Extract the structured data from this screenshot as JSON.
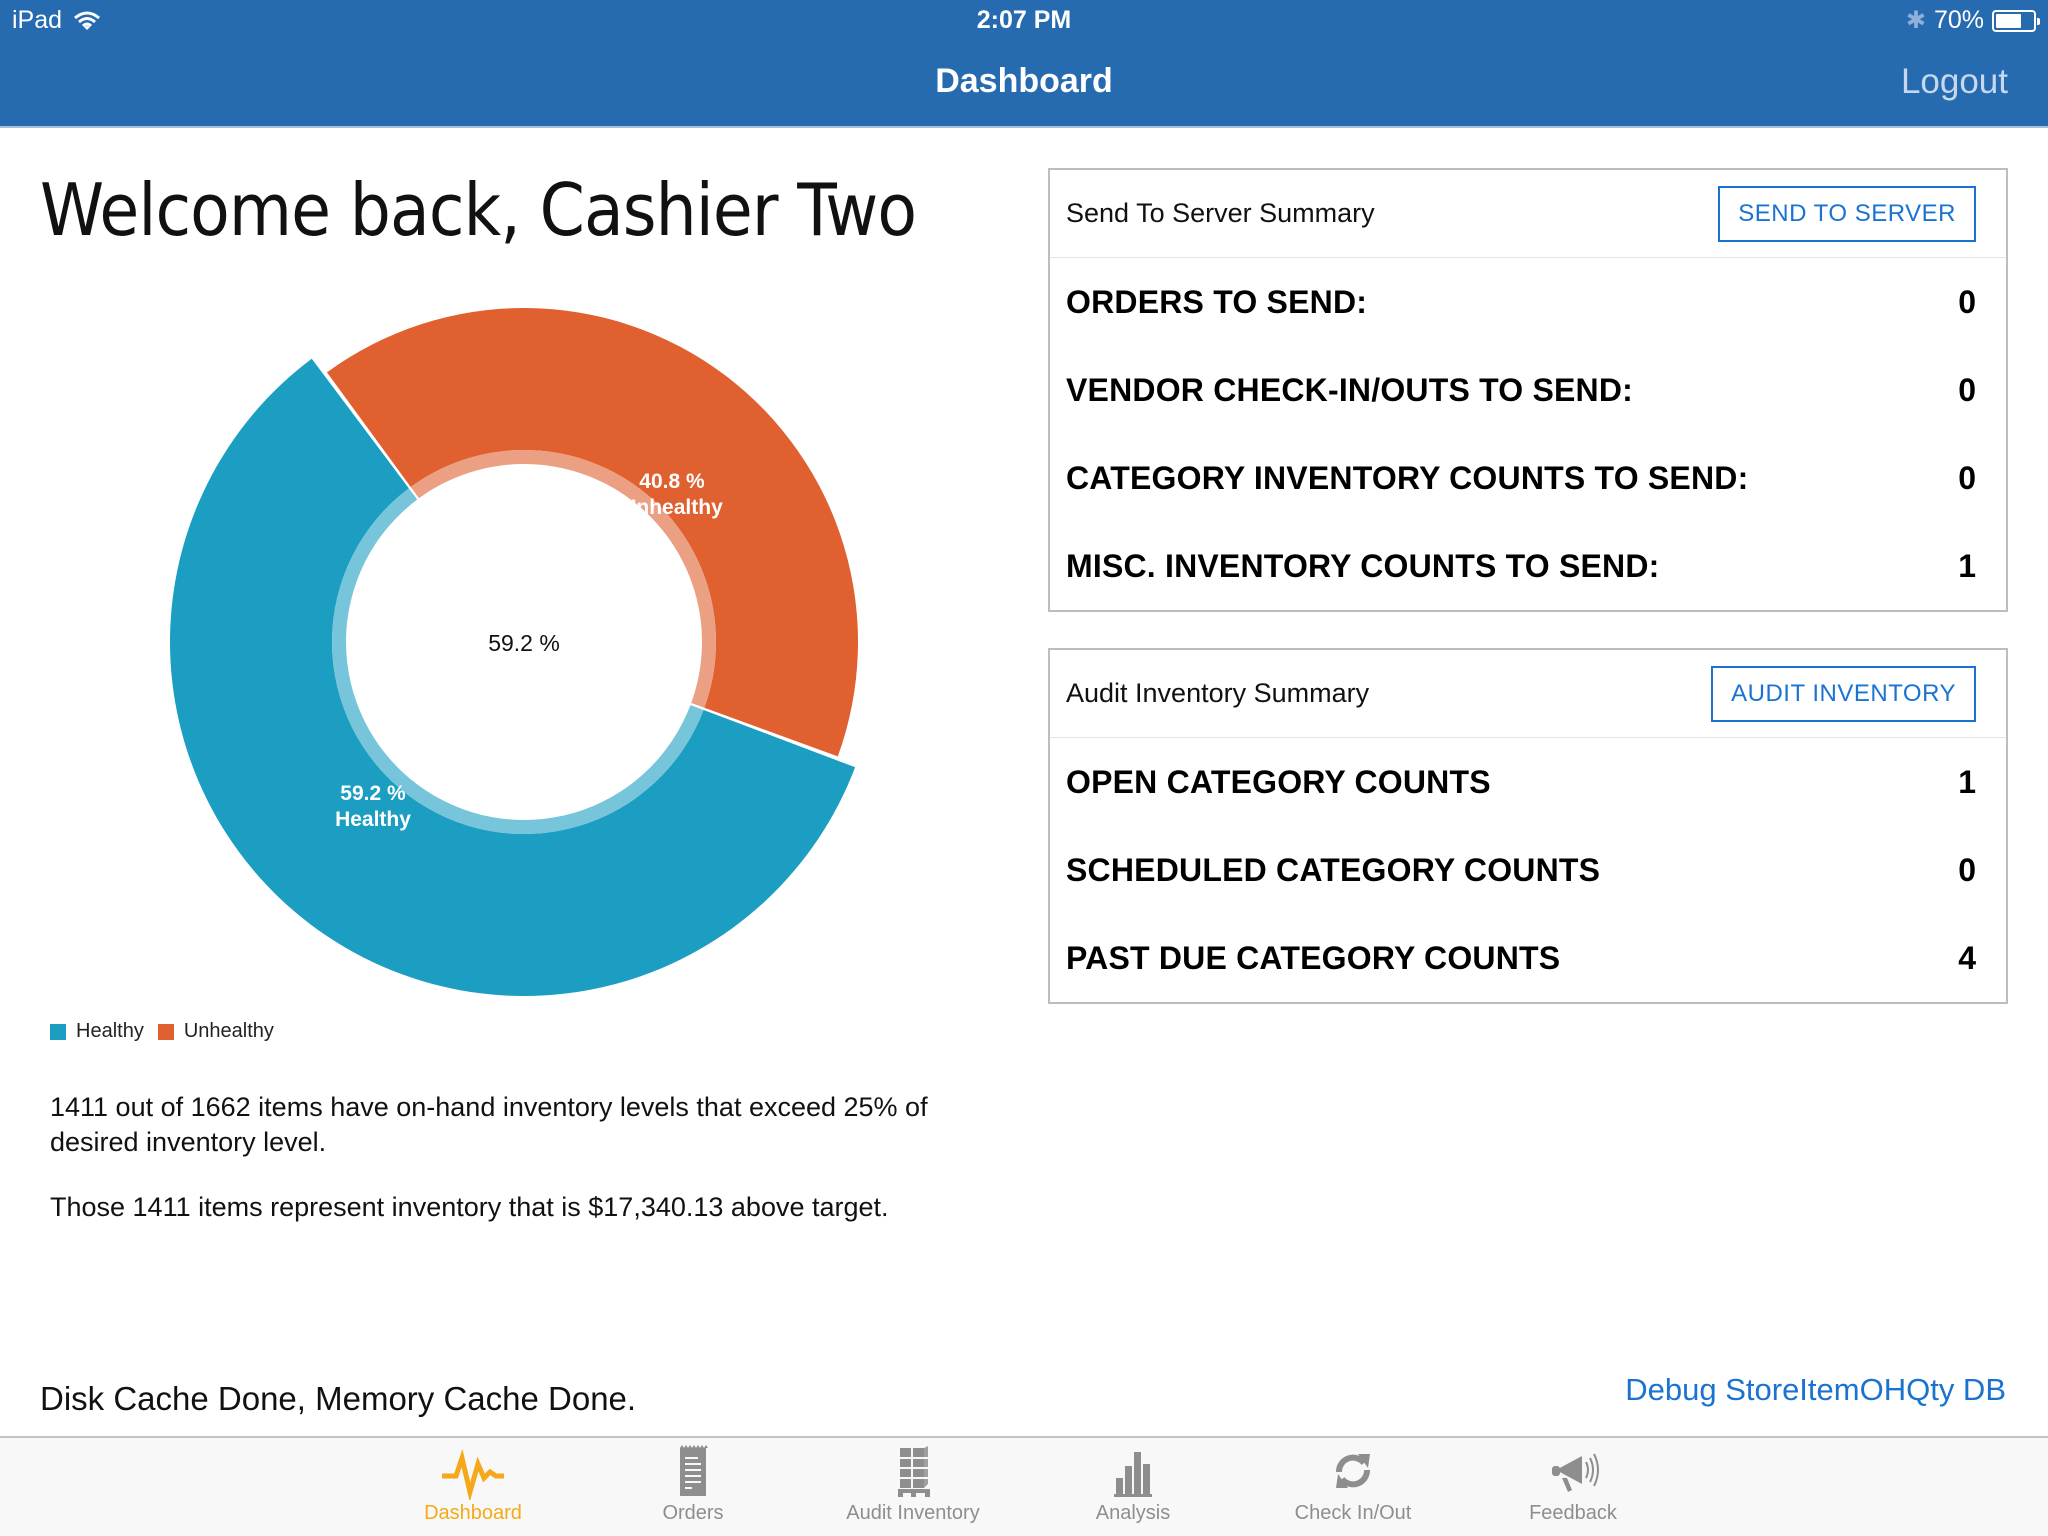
{
  "status_bar": {
    "device": "iPad",
    "time": "2:07 PM",
    "battery_percent_label": "70%",
    "battery_level": 0.7
  },
  "nav": {
    "title": "Dashboard",
    "logout_label": "Logout"
  },
  "welcome": "Welcome back, Cashier Two",
  "chart_data": {
    "type": "pie",
    "variant": "donut",
    "center_label": "59.2 %",
    "series": [
      {
        "name": "Healthy",
        "value": 59.2,
        "label_line1": "59.2 %",
        "label_line2": "Healthy",
        "color": "#1b9ec2",
        "selected": true
      },
      {
        "name": "Unhealthy",
        "value": 40.8,
        "label_line1": "40.8 %",
        "label_line2": "Unhealthy",
        "color": "#e06030",
        "selected": false
      }
    ],
    "legend": [
      "Healthy",
      "Unhealthy"
    ],
    "legend_position": "bottom-left"
  },
  "summary": {
    "line1": "1411 out of 1662 items have on-hand inventory levels that exceed 25% of desired inventory level.",
    "line2": "Those 1411 items represent inventory that is $17,340.13 above target."
  },
  "send_panel": {
    "title": "Send To Server Summary",
    "button_label": "SEND TO SERVER",
    "rows": [
      {
        "label": "ORDERS TO SEND:",
        "value": "0"
      },
      {
        "label": "VENDOR CHECK-IN/OUTS TO SEND:",
        "value": "0"
      },
      {
        "label": "CATEGORY INVENTORY COUNTS TO SEND:",
        "value": "0"
      },
      {
        "label": "MISC. INVENTORY COUNTS TO SEND:",
        "value": "1"
      }
    ]
  },
  "audit_panel": {
    "title": "Audit Inventory Summary",
    "button_label": "AUDIT INVENTORY",
    "rows": [
      {
        "label": "OPEN CATEGORY COUNTS",
        "value": "1"
      },
      {
        "label": "SCHEDULED CATEGORY COUNTS",
        "value": "0"
      },
      {
        "label": "PAST DUE CATEGORY COUNTS",
        "value": "4"
      }
    ]
  },
  "footer": {
    "cache_status": "Disk Cache Done, Memory Cache Done.",
    "debug_link": "Debug StoreItemOHQty DB"
  },
  "tabs": [
    {
      "label": "Dashboard",
      "icon": "pulse-icon",
      "active": true
    },
    {
      "label": "Orders",
      "icon": "receipt-icon",
      "active": false
    },
    {
      "label": "Audit Inventory",
      "icon": "pallet-icon",
      "active": false
    },
    {
      "label": "Analysis",
      "icon": "bar-chart-icon",
      "active": false
    },
    {
      "label": "Check In/Out",
      "icon": "refresh-icon",
      "active": false
    },
    {
      "label": "Feedback",
      "icon": "megaphone-icon",
      "active": false
    }
  ],
  "colors": {
    "nav_bar": "#266bb0",
    "accent": "#1a73d1",
    "active_tab": "#f5a91a",
    "inactive_tab": "#8e8e8e"
  }
}
